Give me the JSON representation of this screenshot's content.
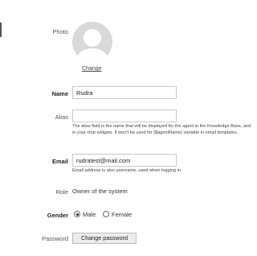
{
  "photo": {
    "label": "Photo",
    "change_link": "Change"
  },
  "name": {
    "label": "Name",
    "value": "Rudra"
  },
  "alias": {
    "label": "Alias",
    "value": "",
    "help": "The alias field is the name that will be displayed for the agent in the Knowledge Base, and in your chat widgets. It won't be used for {$agentName} variable in email templates."
  },
  "email": {
    "label": "Email",
    "value": "rudratest@mail.com",
    "help": "Email address is also username, used when logging in"
  },
  "role": {
    "label": "Role",
    "value": "Owner of the system"
  },
  "gender": {
    "label": "Gender",
    "options": [
      {
        "label": "Male",
        "checked": true
      },
      {
        "label": "Female",
        "checked": false
      }
    ]
  },
  "password": {
    "label": "Password",
    "button": "Change password"
  }
}
